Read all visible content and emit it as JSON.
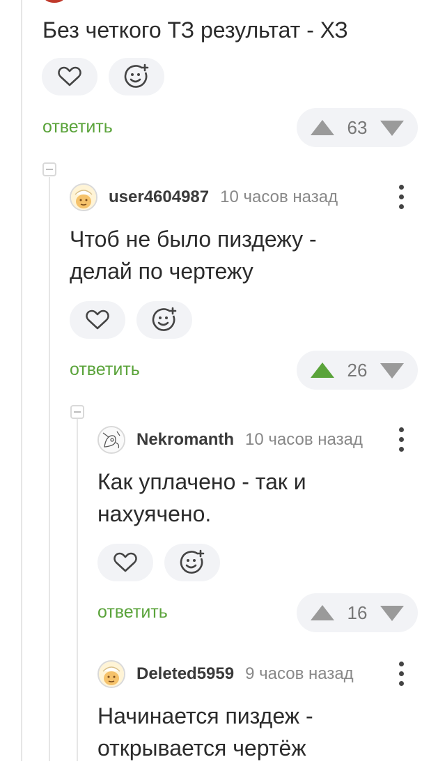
{
  "colors": {
    "accent": "#5aa33a",
    "pill_bg": "#f2f3f6",
    "text": "#2b2b2b",
    "muted": "#888888"
  },
  "comments": [
    {
      "text": "Без четкого ТЗ результат - ХЗ",
      "reply_label": "ответить",
      "rating": "63",
      "upvoted": false,
      "icons": [
        "heart-icon",
        "add-reaction-icon"
      ]
    },
    {
      "author": "user4604987",
      "time": "10 часов назад",
      "text": "Чтоб не было пиздежу -\nделай по чертежу",
      "reply_label": "ответить",
      "rating": "26",
      "upvoted": true
    },
    {
      "author": "Nekromanth",
      "time": "10 часов назад",
      "text": "Как уплачено - так и\nнахуячено.",
      "reply_label": "ответить",
      "rating": "16",
      "upvoted": false
    },
    {
      "author": "Deleted5959",
      "time": "9 часов назад",
      "text": "Начинается пиздеж -\nоткрывается чертёж"
    }
  ]
}
